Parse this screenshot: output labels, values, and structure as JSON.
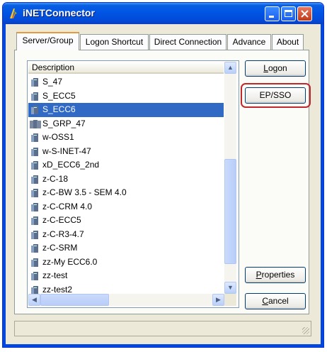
{
  "window": {
    "title": "iNETConnector"
  },
  "tabs": [
    {
      "label": "Server/Group",
      "active": true
    },
    {
      "label": "Logon Shortcut",
      "active": false
    },
    {
      "label": "Direct Connection",
      "active": false
    },
    {
      "label": "Advance",
      "active": false
    },
    {
      "label": "About",
      "active": false
    }
  ],
  "list": {
    "header": "Description",
    "items": [
      {
        "label": "S_47",
        "icon": "server-icon"
      },
      {
        "label": "S_ECC5",
        "icon": "server-icon"
      },
      {
        "label": "S_ECC6",
        "icon": "server-icon",
        "selected": true
      },
      {
        "label": "S_GRP_47",
        "icon": "server-group-icon"
      },
      {
        "label": "w-OSS1",
        "icon": "server-icon"
      },
      {
        "label": "w-S-INET-47",
        "icon": "server-icon"
      },
      {
        "label": "xD_ECC6_2nd",
        "icon": "server-icon"
      },
      {
        "label": "z-C-18",
        "icon": "server-icon"
      },
      {
        "label": "z-C-BW 3.5 - SEM 4.0",
        "icon": "server-icon"
      },
      {
        "label": "z-C-CRM 4.0",
        "icon": "server-icon"
      },
      {
        "label": "z-C-ECC5",
        "icon": "server-icon"
      },
      {
        "label": "z-C-R3-4.7",
        "icon": "server-icon"
      },
      {
        "label": "z-C-SRM",
        "icon": "server-icon"
      },
      {
        "label": "zz-My ECC6.0",
        "icon": "server-icon"
      },
      {
        "label": "zz-test",
        "icon": "server-icon"
      },
      {
        "label": "zz-test2",
        "icon": "server-icon"
      }
    ]
  },
  "buttons": {
    "logon": "Logon",
    "ep_sso": "EP/SSO",
    "properties": "Properties",
    "cancel": "Cancel"
  },
  "colors": {
    "selection": "#316ac5",
    "highlight_box": "#c0282a",
    "titlebar": "#0055e5"
  }
}
